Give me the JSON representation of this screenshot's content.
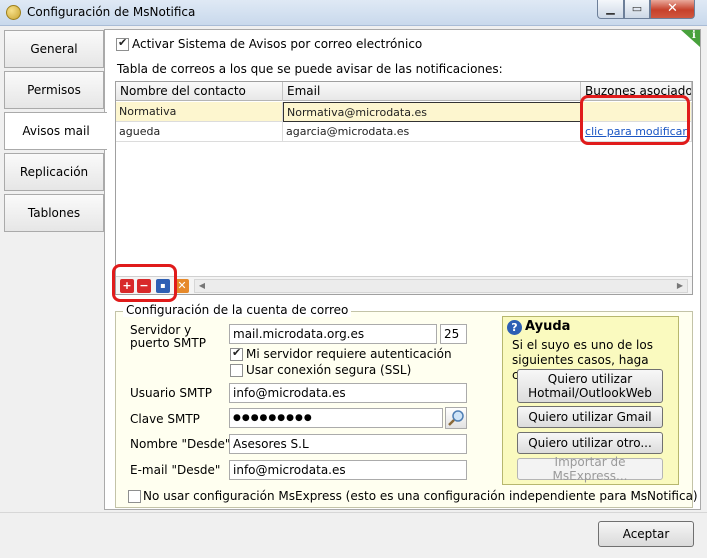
{
  "window": {
    "title": "Configuración de MsNotifica",
    "minimize": "▁",
    "maximize": "▭",
    "close": "✕"
  },
  "tabs": [
    {
      "label": "General"
    },
    {
      "label": "Permisos"
    },
    {
      "label": "Avisos mail"
    },
    {
      "label": "Replicación"
    },
    {
      "label": "Tablones"
    }
  ],
  "info_badge": "i",
  "activate_mail": {
    "label": "Activar Sistema de Avisos por correo electrónico",
    "checked": true
  },
  "table": {
    "caption": "Tabla de correos a los que se puede avisar de las notificaciones:",
    "columns": [
      "Nombre del contacto",
      "Email",
      "Buzones asociados"
    ],
    "rows": [
      {
        "name": "Normativa",
        "email": "Normativa@microdata.es",
        "mailboxes": ""
      },
      {
        "name": "agueda",
        "email": "agarcia@microdata.es",
        "mailboxes": "clic para modificar"
      }
    ],
    "toolbar": {
      "add": "+",
      "remove": "−",
      "save": "▪",
      "cancel": "✕"
    },
    "scroll_left": "◀",
    "scroll_right": "▶"
  },
  "config": {
    "group_title": "Configuración de la cuenta de correo",
    "smtp_label_1": "Servidor y",
    "smtp_label_2": "puerto SMTP",
    "smtp_server": "mail.microdata.org.es",
    "smtp_port": "25",
    "auth_required": {
      "label": "Mi servidor requiere autenticación",
      "checked": true
    },
    "ssl": {
      "label": "Usar conexión segura (SSL)",
      "checked": false
    },
    "user_label": "Usuario SMTP",
    "user_value": "info@microdata.es",
    "password_label": "Clave SMTP",
    "password_value": "●●●●●●●●●",
    "from_name_label": "Nombre \"Desde\"",
    "from_name_value": "Asesores S.L",
    "from_email_label": "E-mail \"Desde\"",
    "from_email_value": "info@microdata.es",
    "no_msexpress": {
      "label": "No usar configuración MsExpress (esto es una configuración independiente para MsNotifica)",
      "checked": false
    }
  },
  "help": {
    "title": "Ayuda",
    "icon": "?",
    "text": "Si el suyo es uno de los siguientes casos, haga clic:",
    "btn_hotmail_1": "Quiero utilizar",
    "btn_hotmail_2": "Hotmail/OutlookWeb",
    "btn_gmail": "Quiero utilizar Gmail",
    "btn_other": "Quiero utilizar otro...",
    "btn_import": "Importar de MsExpress..."
  },
  "ok_button": "Aceptar",
  "colors": {
    "annotation": "#e01b1b",
    "link": "#1a56c4",
    "selected_row": "#fdf6cf",
    "help_bg": "#fafabf"
  }
}
